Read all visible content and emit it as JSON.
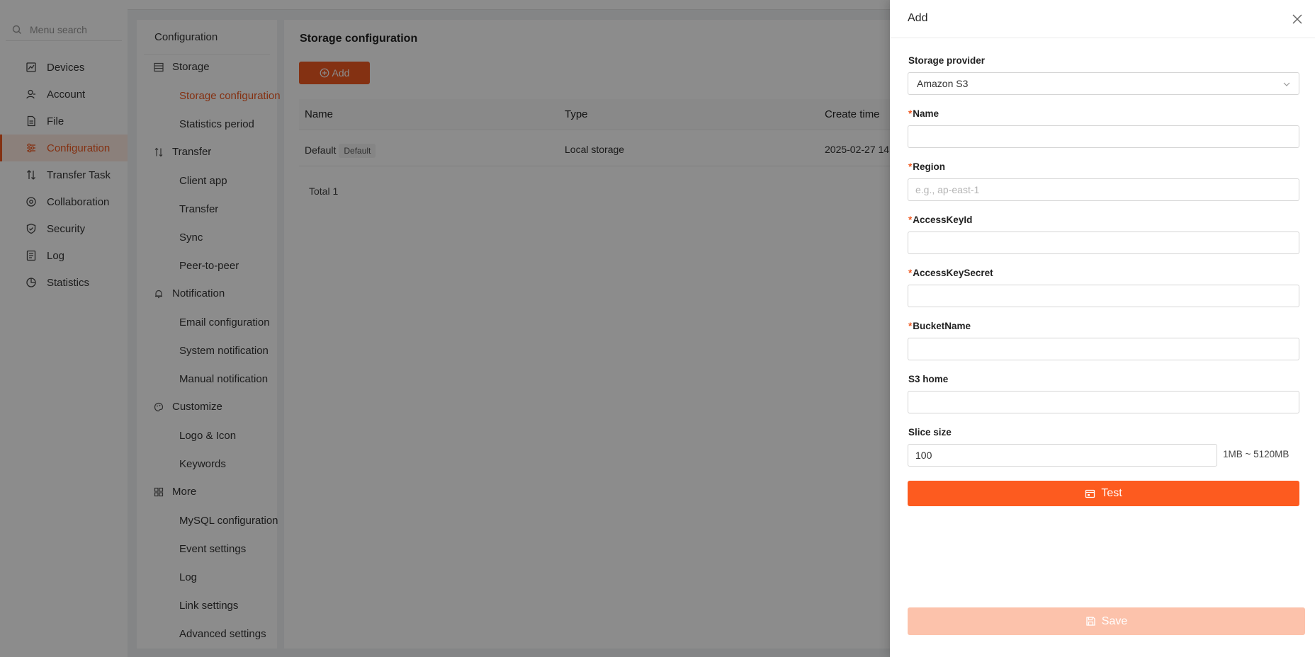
{
  "sidebar": {
    "search_placeholder": "Menu search",
    "items": [
      {
        "label": "Devices",
        "icon": "chart-icon"
      },
      {
        "label": "Account",
        "icon": "user-icon"
      },
      {
        "label": "File",
        "icon": "file-icon"
      },
      {
        "label": "Configuration",
        "icon": "sliders-icon",
        "active": true
      },
      {
        "label": "Transfer Task",
        "icon": "transfer-icon"
      },
      {
        "label": "Collaboration",
        "icon": "collab-icon"
      },
      {
        "label": "Security",
        "icon": "shield-icon"
      },
      {
        "label": "Log",
        "icon": "log-icon"
      },
      {
        "label": "Statistics",
        "icon": "pie-icon"
      }
    ]
  },
  "submenu": {
    "title": "Configuration",
    "groups": {
      "storage": "Storage",
      "transfer": "Transfer",
      "notification": "Notification",
      "customize": "Customize",
      "more": "More"
    },
    "items": {
      "storage_configuration": "Storage configuration",
      "statistics_period": "Statistics period",
      "client_app": "Client app",
      "transfer": "Transfer",
      "sync": "Sync",
      "peer_to_peer": "Peer-to-peer",
      "email_configuration": "Email configuration",
      "system_notification": "System notification",
      "manual_notification": "Manual notification",
      "logo_icon": "Logo & Icon",
      "keywords": "Keywords",
      "mysql_configuration": "MySQL configuration",
      "event_settings": "Event settings",
      "log": "Log",
      "link_settings": "Link settings",
      "advanced_settings": "Advanced settings"
    }
  },
  "content": {
    "title": "Storage configuration",
    "add_label": "Add",
    "table": {
      "headers": {
        "name": "Name",
        "type": "Type",
        "create_time": "Create time"
      },
      "rows": [
        {
          "name": "Default",
          "badge": "Default",
          "type": "Local storage",
          "create_time": "2025-02-27 14:"
        }
      ]
    },
    "total": "Total 1"
  },
  "drawer": {
    "title": "Add",
    "storage_provider_label": "Storage provider",
    "storage_provider_value": "Amazon S3",
    "required_mark": "*",
    "name_label": "Name",
    "name_value": "",
    "region_label": "Region",
    "region_placeholder": "e.g., ap-east-1",
    "region_value": "",
    "access_key_id_label": "AccessKeyId",
    "access_key_id_value": "",
    "access_key_secret_label": "AccessKeySecret",
    "access_key_secret_value": "",
    "bucket_name_label": "BucketName",
    "bucket_name_value": "",
    "s3_home_label": "S3 home",
    "s3_home_value": "",
    "slice_size_label": "Slice size",
    "slice_size_value": "100",
    "slice_size_hint": "1MB ~ 5120MB",
    "test_label": "Test",
    "save_label": "Save"
  },
  "colors": {
    "accent": "#f05a22",
    "test_button": "#fd5b1f",
    "save_button_disabled": "#fcc2ab"
  }
}
